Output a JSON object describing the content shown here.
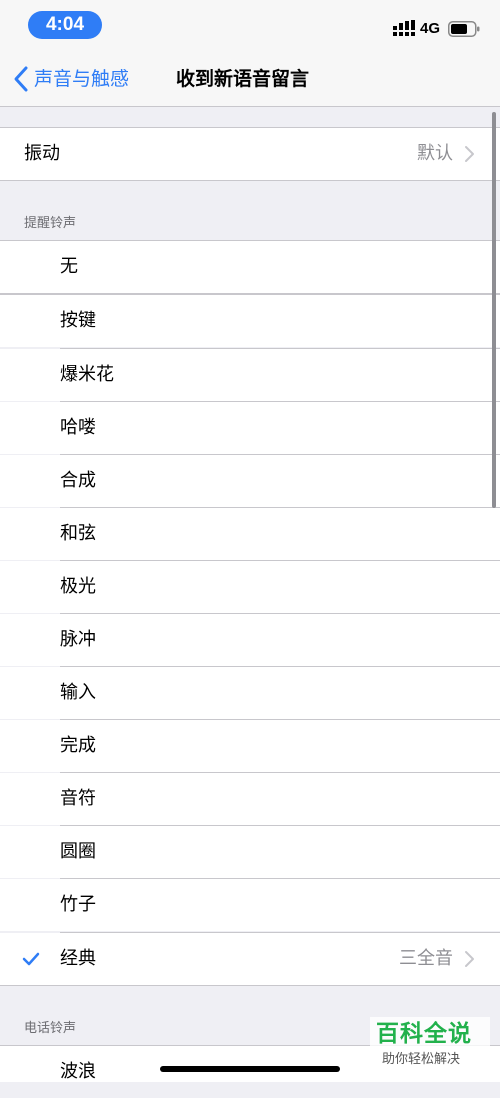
{
  "status_bar": {
    "time": "4:04",
    "network": "4G"
  },
  "nav": {
    "back_label": "声音与触感",
    "title": "收到新语音留言"
  },
  "vibration": {
    "label": "振动",
    "value": "默认"
  },
  "alert_tones": {
    "header": "提醒铃声",
    "none_label": "无",
    "items": [
      "按键",
      "爆米花",
      "哈喽",
      "合成",
      "和弦",
      "极光",
      "脉冲",
      "输入",
      "完成",
      "音符",
      "圆圈",
      "竹子"
    ],
    "selected": {
      "label": "经典",
      "value": "三全音"
    }
  },
  "ringtones": {
    "header": "电话铃声",
    "items": [
      "波浪"
    ]
  },
  "watermark": {
    "title": "百科全说",
    "subtitle": "助你轻松解决"
  },
  "colors": {
    "accent": "#2f7df6",
    "background": "#efeff4",
    "secondary_text": "#8e8e93",
    "watermark_green": "#22b14c"
  }
}
